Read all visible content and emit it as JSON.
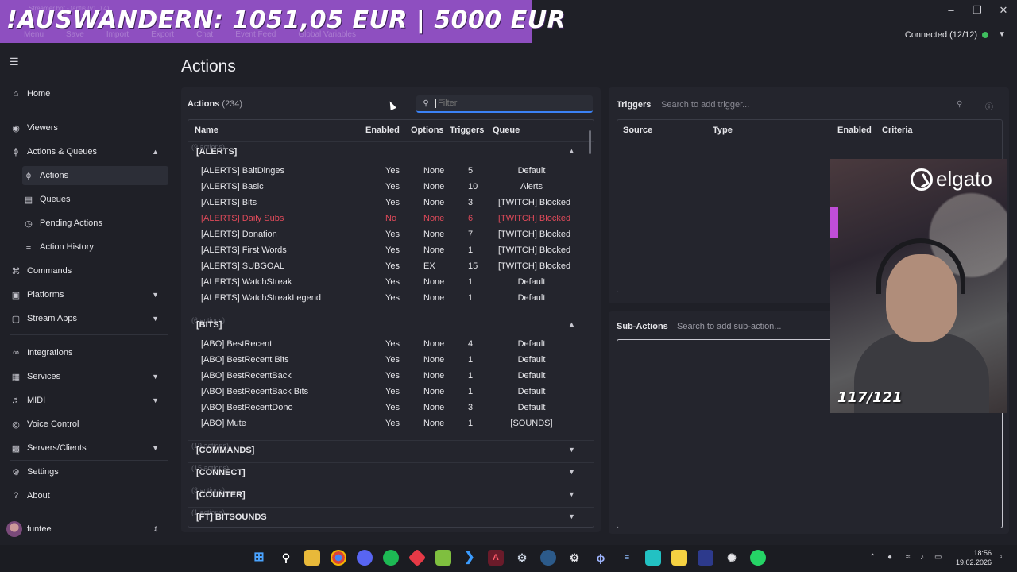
{
  "overlay": {
    "banner_text": "!AUSWANDERN: 1051,05 EUR | 5000 EUR",
    "app_title": "Streamer.bot - fantis (v1.0.4)",
    "menu": [
      "Menu",
      "Save",
      "Import",
      "Export",
      "Chat",
      "Event Feed",
      "Global Variables"
    ]
  },
  "header": {
    "connection": "Connected (12/12)"
  },
  "sidebar": {
    "items": [
      {
        "label": "Home",
        "icon": "home-icon"
      },
      {
        "label": "Viewers",
        "icon": "viewers-icon"
      },
      {
        "label": "Actions & Queues",
        "icon": "bolt-icon"
      },
      {
        "label": "Actions",
        "icon": "bolt-icon"
      },
      {
        "label": "Queues",
        "icon": "queue-icon"
      },
      {
        "label": "Pending Actions",
        "icon": "clock-icon"
      },
      {
        "label": "Action History",
        "icon": "list-icon"
      },
      {
        "label": "Commands",
        "icon": "command-icon"
      },
      {
        "label": "Platforms",
        "icon": "platforms-icon"
      },
      {
        "label": "Stream Apps",
        "icon": "apps-icon"
      },
      {
        "label": "Integrations",
        "icon": "integrations-icon"
      },
      {
        "label": "Services",
        "icon": "services-icon"
      },
      {
        "label": "MIDI",
        "icon": "midi-icon"
      },
      {
        "label": "Voice Control",
        "icon": "mic-icon"
      },
      {
        "label": "Servers/Clients",
        "icon": "server-icon"
      },
      {
        "label": "Settings",
        "icon": "gear-icon"
      },
      {
        "label": "About",
        "icon": "question-icon"
      }
    ],
    "user": "funtee"
  },
  "page": {
    "title": "Actions"
  },
  "actions": {
    "label": "Actions",
    "count": "(234)",
    "filter_placeholder": "Filter",
    "columns": [
      "Name",
      "Enabled",
      "Options",
      "Triggers",
      "Queue"
    ],
    "groups": [
      {
        "name": "[ALERTS]",
        "count": "(9 actions)",
        "expanded": true,
        "rows": [
          {
            "name": "[ALERTS] BaitDinges",
            "enabled": "Yes",
            "options": "None",
            "triggers": "5",
            "queue": "Default"
          },
          {
            "name": "[ALERTS] Basic",
            "enabled": "Yes",
            "options": "None",
            "triggers": "10",
            "queue": "Alerts"
          },
          {
            "name": "[ALERTS] Bits",
            "enabled": "Yes",
            "options": "None",
            "triggers": "3",
            "queue": "[TWITCH] Blocked"
          },
          {
            "name": "[ALERTS] Daily Subs",
            "enabled": "No",
            "options": "None",
            "triggers": "6",
            "queue": "[TWITCH] Blocked"
          },
          {
            "name": "[ALERTS] Donation",
            "enabled": "Yes",
            "options": "None",
            "triggers": "7",
            "queue": "[TWITCH] Blocked"
          },
          {
            "name": "[ALERTS] First Words",
            "enabled": "Yes",
            "options": "None",
            "triggers": "1",
            "queue": "[TWITCH] Blocked"
          },
          {
            "name": "[ALERTS] SUBGOAL",
            "enabled": "Yes",
            "options": "EX",
            "triggers": "15",
            "queue": "[TWITCH] Blocked"
          },
          {
            "name": "[ALERTS] WatchStreak",
            "enabled": "Yes",
            "options": "None",
            "triggers": "1",
            "queue": "Default"
          },
          {
            "name": "[ALERTS] WatchStreakLegend",
            "enabled": "Yes",
            "options": "None",
            "triggers": "1",
            "queue": "Default"
          }
        ]
      },
      {
        "name": "[BITS]",
        "count": "(6 actions)",
        "expanded": true,
        "rows": [
          {
            "name": "[ABO] BestRecent",
            "enabled": "Yes",
            "options": "None",
            "triggers": "4",
            "queue": "Default"
          },
          {
            "name": "[ABO] BestRecent Bits",
            "enabled": "Yes",
            "options": "None",
            "triggers": "1",
            "queue": "Default"
          },
          {
            "name": "[ABO] BestRecentBack",
            "enabled": "Yes",
            "options": "None",
            "triggers": "1",
            "queue": "Default"
          },
          {
            "name": "[ABO] BestRecentBack Bits",
            "enabled": "Yes",
            "options": "None",
            "triggers": "1",
            "queue": "Default"
          },
          {
            "name": "[ABO] BestRecentDono",
            "enabled": "Yes",
            "options": "None",
            "triggers": "3",
            "queue": "Default"
          },
          {
            "name": "[ABO] Mute",
            "enabled": "Yes",
            "options": "None",
            "triggers": "1",
            "queue": "[SOUNDS]"
          }
        ]
      },
      {
        "name": "[COMMANDS]",
        "count": "(19 actions)",
        "expanded": false,
        "rows": []
      },
      {
        "name": "[CONNECT]",
        "count": "(15 actions)",
        "expanded": false,
        "rows": []
      },
      {
        "name": "[COUNTER]",
        "count": "(3 actions)",
        "expanded": false,
        "rows": []
      },
      {
        "name": "[FT] BITSOUNDS",
        "count": "(1 actions)",
        "expanded": false,
        "rows": []
      }
    ]
  },
  "triggers": {
    "label": "Triggers",
    "search_placeholder": "Search to add trigger...",
    "columns": [
      "Source",
      "Type",
      "Enabled",
      "Criteria"
    ]
  },
  "sub_actions": {
    "label": "Sub-Actions",
    "search_placeholder": "Search to add sub-action..."
  },
  "webcam": {
    "logo": "elgato",
    "counter": "117/121"
  },
  "taskbar": {
    "time": "18:56",
    "date": "19.02.2026"
  },
  "colors": {
    "accent": "#3b82f6",
    "disabled_row": "#e04a5a",
    "banner": "#8e4fc0",
    "connected_dot": "#3fbf5f"
  }
}
